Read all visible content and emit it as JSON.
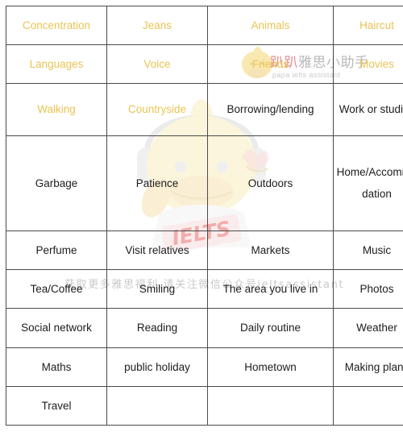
{
  "table": {
    "columns": 4,
    "rows": 10,
    "highlight_color": "#e9c453",
    "text_color": "#1d1d1d",
    "border_color": "#4a4a4a",
    "cells": [
      [
        {
          "text": "Concentration",
          "highlight": true
        },
        {
          "text": "Jeans",
          "highlight": true
        },
        {
          "text": "Animals",
          "highlight": true
        },
        {
          "text": "Haircut",
          "highlight": true
        }
      ],
      [
        {
          "text": "Languages",
          "highlight": true
        },
        {
          "text": "Voice",
          "highlight": true
        },
        {
          "text": "Friends",
          "highlight": true
        },
        {
          "text": "Movies",
          "highlight": true
        }
      ],
      [
        {
          "text": "Walking",
          "highlight": true
        },
        {
          "text": "Countryside",
          "highlight": true
        },
        {
          "text": "Borrowing/lending",
          "highlight": false
        },
        {
          "text": "Work or studies",
          "highlight": false,
          "wrap": true
        }
      ],
      [
        {
          "text": "Garbage",
          "highlight": false
        },
        {
          "text": "Patience",
          "highlight": false
        },
        {
          "text": "Outdoors",
          "highlight": false
        },
        {
          "text": "Home/Accommodation",
          "highlight": false,
          "wrap": true
        }
      ],
      [
        {
          "text": "Perfume",
          "highlight": false
        },
        {
          "text": "Visit relatives",
          "highlight": false
        },
        {
          "text": "Markets",
          "highlight": false
        },
        {
          "text": "Music",
          "highlight": false
        }
      ],
      [
        {
          "text": "Tea/Coffee",
          "highlight": false
        },
        {
          "text": "Smiling",
          "highlight": false
        },
        {
          "text": "The area you live in",
          "highlight": false
        },
        {
          "text": "Photos",
          "highlight": false
        }
      ],
      [
        {
          "text": "Social network",
          "highlight": false
        },
        {
          "text": "Reading",
          "highlight": false
        },
        {
          "text": "Daily routine",
          "highlight": false
        },
        {
          "text": "Weather",
          "highlight": false
        }
      ],
      [
        {
          "text": "Maths",
          "highlight": false
        },
        {
          "text": "public holiday",
          "highlight": false
        },
        {
          "text": "Hometown",
          "highlight": false
        },
        {
          "text": "Making plans",
          "highlight": false
        }
      ],
      [
        {
          "text": "Travel",
          "highlight": false
        },
        {
          "text": "",
          "highlight": false
        },
        {
          "text": "",
          "highlight": false
        },
        {
          "text": "",
          "highlight": false
        }
      ]
    ]
  },
  "watermark": {
    "brand_cn": "趴趴雅思小助手",
    "brand_cn_red_part": "趴趴",
    "brand_cn_gray_part": "雅思小助手",
    "brand_en": "papa ielts assistant",
    "bottom_line": "获取更多雅思福利,请关注微信公众号ieltsassistant",
    "mascot_label": "IELTS",
    "mascot_color": "#f7e7a8",
    "brand_red": "#e8888a",
    "brand_gray": "#b9b9b9"
  }
}
